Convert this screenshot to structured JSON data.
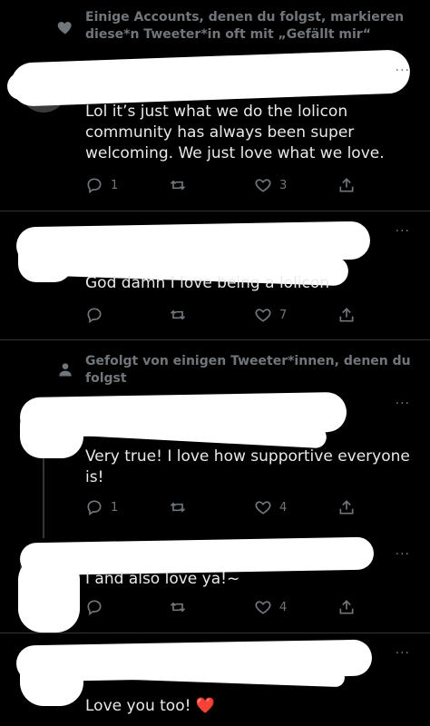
{
  "tweets": [
    {
      "context": "Einige Accounts, denen du folgst, markieren diese*n Tweeter*in oft mit „Gefällt mir“",
      "context_icon": "heart-icon",
      "text": "Lol it’s just what we do the lolicon community has always been super welcoming. We just love what we love.",
      "replies": "1",
      "retweets": "",
      "likes": "3"
    },
    {
      "text": "God damn I love being a lolicon",
      "replies": "",
      "retweets": "",
      "likes": "7"
    },
    {
      "context": "Gefolgt von einigen Tweeter*innen, denen du folgst",
      "context_icon": "person-icon",
      "text": "Very true! I love how supportive everyone is!",
      "replies": "1",
      "retweets": "",
      "likes": "4"
    },
    {
      "text": "I and also love ya!~",
      "replies": "",
      "retweets": "",
      "likes": "4"
    },
    {
      "text": "Love you too! ❤️"
    }
  ],
  "more_label": "···"
}
